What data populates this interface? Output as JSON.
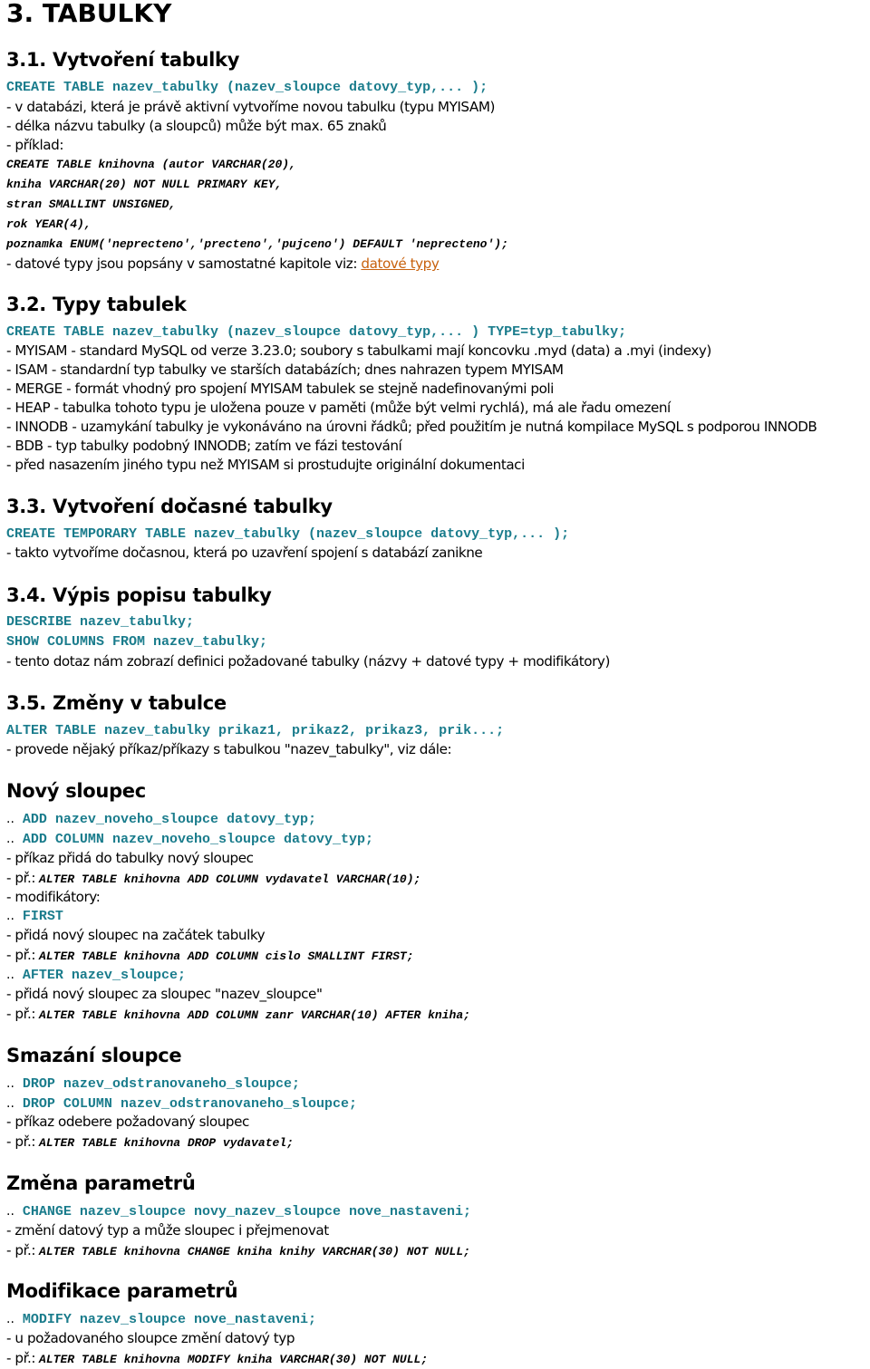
{
  "title": "3. TABULKY",
  "sections": {
    "s31": {
      "heading": "3.1. Vytvoření tabulky",
      "syntax": "CREATE TABLE nazev_tabulky (nazev_sloupce datovy_typ,... );",
      "notes": [
        "- v databázi, která je právě aktivní vytvoříme novou tabulku (typu MYISAM)",
        "- délka názvu tabulky (a sloupců) může být max. 65 znaků",
        "- příklad:"
      ],
      "example": [
        "CREATE TABLE knihovna (autor VARCHAR(20),",
        "kniha VARCHAR(20) NOT NULL PRIMARY KEY,",
        "stran SMALLINT UNSIGNED,",
        "rok YEAR(4),",
        "poznamka ENUM('neprecteno','precteno','pujceno') DEFAULT 'neprecteno');"
      ],
      "see_text": "- datové typy jsou popsány v samostatné kapitole viz: ",
      "see_link": "datové typy"
    },
    "s32": {
      "heading": "3.2. Typy tabulek",
      "syntax": "CREATE TABLE nazev_tabulky (nazev_sloupce datovy_typ,... ) TYPE=typ_tabulky;",
      "notes": [
        "- MYISAM - standard MySQL od verze 3.23.0; soubory s tabulkami mají koncovku .myd (data) a .myi (indexy)",
        "- ISAM - standardní typ tabulky ve starších databázích; dnes nahrazen typem MYISAM",
        "- MERGE - formát vhodný pro spojení MYISAM tabulek se stejně nadefinovanými poli",
        "- HEAP - tabulka tohoto typu je uložena pouze v paměti (může být velmi rychlá), má ale řadu omezení",
        "- INNODB - uzamykání tabulky je vykonáváno na úrovni řádků; před použitím je nutná kompilace MySQL s podporou INNODB",
        "- BDB - typ tabulky podobný INNODB; zatím ve fázi testování",
        "- před nasazením jiného typu než MYISAM si prostudujte originální dokumentaci"
      ]
    },
    "s33": {
      "heading": "3.3. Vytvoření dočasné tabulky",
      "syntax": "CREATE TEMPORARY TABLE nazev_tabulky (nazev_sloupce datovy_typ,... );",
      "notes": [
        "- takto vytvoříme dočasnou, která po uzavření spojení s databází zanikne"
      ]
    },
    "s34": {
      "heading": "3.4. Výpis popisu tabulky",
      "syntax": [
        "DESCRIBE nazev_tabulky;",
        "SHOW COLUMNS FROM nazev_tabulky;"
      ],
      "notes": [
        "- tento dotaz nám zobrazí definici požadované tabulky (názvy + datové typy + modifikátory)"
      ]
    },
    "s35": {
      "heading": "3.5. Změny v tabulce",
      "syntax": "ALTER TABLE nazev_tabulky prikaz1, prikaz2, prikaz3, prik...;",
      "notes": [
        "- provede nějaký příkaz/příkazy s tabulkou \"nazev_tabulky\", viz dále:"
      ]
    },
    "novy": {
      "heading": "Nový sloupec",
      "dots": "..",
      "ex_prefix": "- př.:",
      "syntax1": "ADD nazev_noveho_sloupce datovy_typ;",
      "syntax2": "ADD COLUMN nazev_noveho_sloupce datovy_typ;",
      "desc": "- příkaz přidá do tabulky nový sloupec",
      "example": "ALTER TABLE knihovna ADD COLUMN vydavatel VARCHAR(10);",
      "modifiers_label": "- modifikátory:",
      "first_syntax": "FIRST",
      "first_desc": "- přidá nový sloupec na začátek tabulky",
      "first_example": "ALTER TABLE knihovna ADD COLUMN cislo SMALLINT FIRST;",
      "after_syntax": "AFTER nazev_sloupce;",
      "after_desc": "- přidá nový sloupec za sloupec \"nazev_sloupce\"",
      "after_example": "ALTER TABLE knihovna ADD COLUMN zanr VARCHAR(10) AFTER kniha;"
    },
    "smazani": {
      "heading": "Smazání sloupce",
      "syntax1": "DROP nazev_odstranovaneho_sloupce;",
      "syntax2": "DROP COLUMN nazev_odstranovaneho_sloupce;",
      "desc": "- příkaz odebere požadovaný sloupec",
      "example": "ALTER TABLE knihovna DROP vydavatel;"
    },
    "zmena": {
      "heading": "Změna parametrů",
      "syntax": "CHANGE nazev_sloupce novy_nazev_sloupce nove_nastaveni;",
      "desc": "- změní datový typ a může sloupec i přejmenovat",
      "example": "ALTER TABLE knihovna CHANGE kniha knihy VARCHAR(30) NOT NULL;"
    },
    "modifikace": {
      "heading": "Modifikace parametrů",
      "syntax": "MODIFY nazev_sloupce nove_nastaveni;",
      "desc": "- u požadovaného sloupce změní datový typ",
      "example": "ALTER TABLE knihovna MODIFY kniha VARCHAR(30) NOT NULL;"
    }
  },
  "colors": {
    "code": "#1a7c8c",
    "link": "#c8620e",
    "text": "#000000"
  }
}
